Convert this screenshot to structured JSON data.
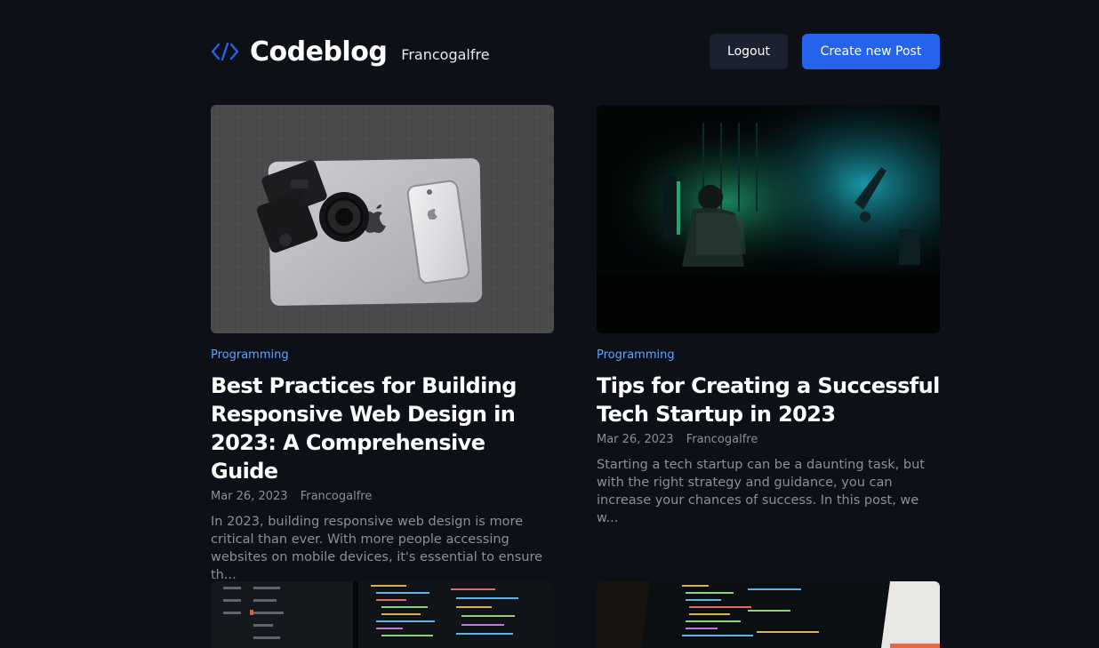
{
  "header": {
    "brand_name": "Codeblog",
    "username": "Francogalfre",
    "logout_label": "Logout",
    "create_label": "Create new Post",
    "brand_color": "#2563eb"
  },
  "posts": [
    {
      "category": "Programming",
      "title": "Best Practices for Building Responsive Web Design in 2023: A Comprehensive Guide",
      "date": "Mar 26, 2023",
      "author": "Francogalfre",
      "excerpt": "In 2023, building responsive web design is more critical than ever. With more people accessing websites on mobile devices, it's essential to ensure th...",
      "image": "laptop-camera-phone-photo"
    },
    {
      "category": "Programming",
      "title": "Tips for Creating a Successful Tech Startup in 2023",
      "date": "Mar 26, 2023",
      "author": "Francogalfre",
      "excerpt": "Starting a tech startup can be a daunting task, but with the right strategy and guidance, you can increase your chances of success. In this post, we w...",
      "image": "developer-dark-room-photo"
    }
  ],
  "partial_posts": [
    {
      "image": "code-monitors-photo"
    },
    {
      "image": "code-laptop-photo"
    }
  ],
  "colors": {
    "background": "#0d1017",
    "category": "#60a5fa",
    "muted": "#8a8f99",
    "primary": "#2563eb",
    "secondary_button": "#1b2130"
  }
}
